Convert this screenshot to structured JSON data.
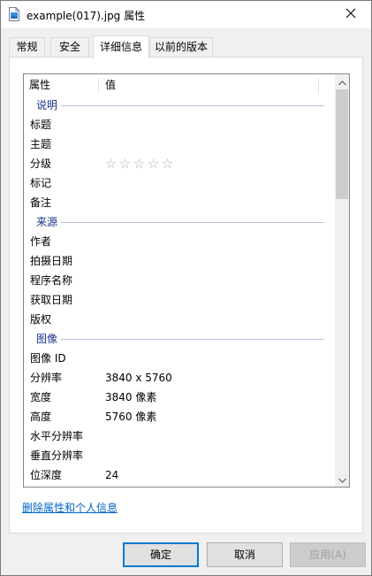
{
  "window": {
    "title": "example(017).jpg 属性"
  },
  "tabs": [
    {
      "label": "常规"
    },
    {
      "label": "安全"
    },
    {
      "label": "详细信息",
      "active": true
    },
    {
      "label": "以前的版本"
    }
  ],
  "details": {
    "columns": {
      "property": "属性",
      "value": "值"
    },
    "groups": {
      "description": {
        "header": "说明",
        "rows": [
          {
            "key": "标题",
            "value": ""
          },
          {
            "key": "主题",
            "value": ""
          },
          {
            "key": "分级",
            "value": "",
            "rating_stars": 0,
            "rating_max": 5
          },
          {
            "key": "标记",
            "value": ""
          },
          {
            "key": "备注",
            "value": ""
          }
        ]
      },
      "origin": {
        "header": "来源",
        "rows": [
          {
            "key": "作者",
            "value": ""
          },
          {
            "key": "拍摄日期",
            "value": ""
          },
          {
            "key": "程序名称",
            "value": ""
          },
          {
            "key": "获取日期",
            "value": ""
          },
          {
            "key": "版权",
            "value": ""
          }
        ]
      },
      "image": {
        "header": "图像",
        "rows": [
          {
            "key": "图像 ID",
            "value": ""
          },
          {
            "key": "分辨率",
            "value": "3840 x 5760"
          },
          {
            "key": "宽度",
            "value": "3840 像素"
          },
          {
            "key": "高度",
            "value": "5760 像素"
          },
          {
            "key": "水平分辨率",
            "value": ""
          },
          {
            "key": "垂直分辨率",
            "value": ""
          },
          {
            "key": "位深度",
            "value": "24"
          }
        ]
      }
    }
  },
  "links": {
    "remove_properties": "删除属性和个人信息"
  },
  "buttons": {
    "ok": "确定",
    "cancel": "取消",
    "apply": "应用(A)"
  },
  "colors": {
    "group_header": "#1e3287",
    "link": "#0066cc",
    "default_button_border": "#0078d7"
  },
  "icons": {
    "title": "image-file-icon",
    "close": "close-icon",
    "star": "star-outline-icon",
    "scroll_up": "chevron-up-icon",
    "scroll_down": "chevron-down-icon"
  }
}
